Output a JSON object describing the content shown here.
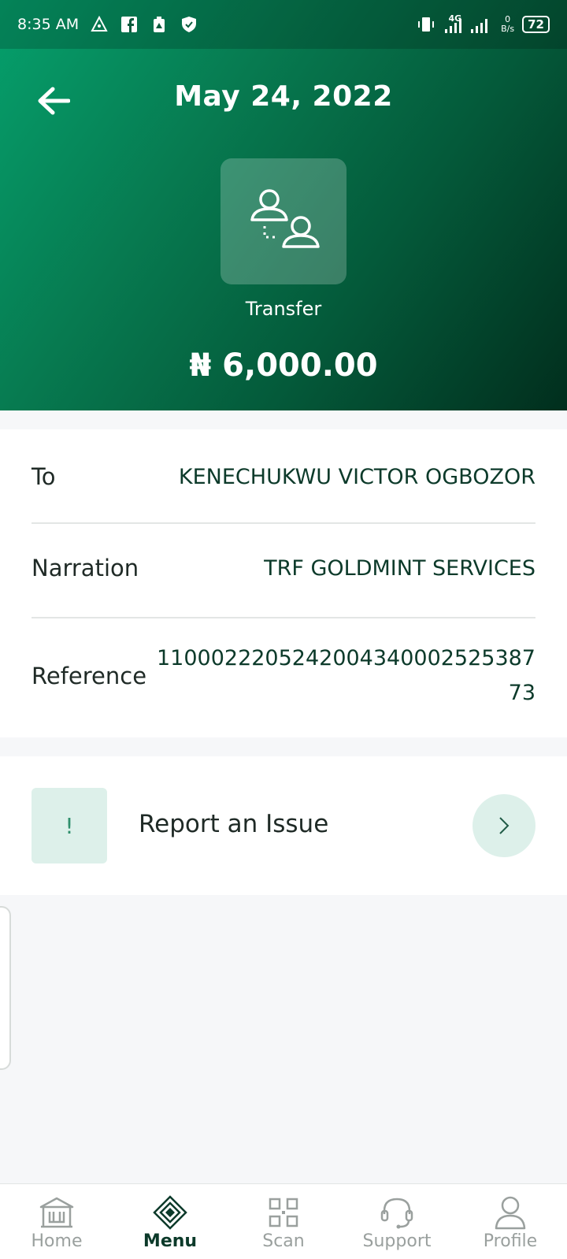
{
  "status_bar": {
    "time": "8:35 AM",
    "network": "4G",
    "net_speed_value": "0",
    "net_speed_unit": "B/s",
    "battery": "72",
    "icons": [
      "navigation-icon",
      "facebook-icon",
      "cleaner-icon",
      "shield-icon",
      "vibrate-icon",
      "signal-icon"
    ]
  },
  "header": {
    "date": "May 24, 2022",
    "type_icon": "transfer-users-icon",
    "type_label": "Transfer",
    "amount": "₦ 6,000.00"
  },
  "details": [
    {
      "label": "To",
      "value": "KENECHUKWU VICTOR OGBOZOR"
    },
    {
      "label": "Narration",
      "value": "TRF GOLDMINT SERVICES"
    },
    {
      "label": "Reference",
      "value_line1": "1100022205242004340002525387",
      "value_line2": "73"
    }
  ],
  "report": {
    "icon_glyph": "!",
    "label": "Report an Issue"
  },
  "bottom_nav": [
    {
      "label": "Home",
      "icon": "home-icon",
      "active": false
    },
    {
      "label": "Menu",
      "icon": "menu-icon",
      "active": true
    },
    {
      "label": "Scan",
      "icon": "qr-scan-icon",
      "active": false
    },
    {
      "label": "Support",
      "icon": "headset-icon",
      "active": false
    },
    {
      "label": "Profile",
      "icon": "user-icon",
      "active": false
    }
  ],
  "colors": {
    "brand_green": "#077a50",
    "dark_green": "#0c3a2a",
    "accent_light": "#ddf0ea"
  }
}
